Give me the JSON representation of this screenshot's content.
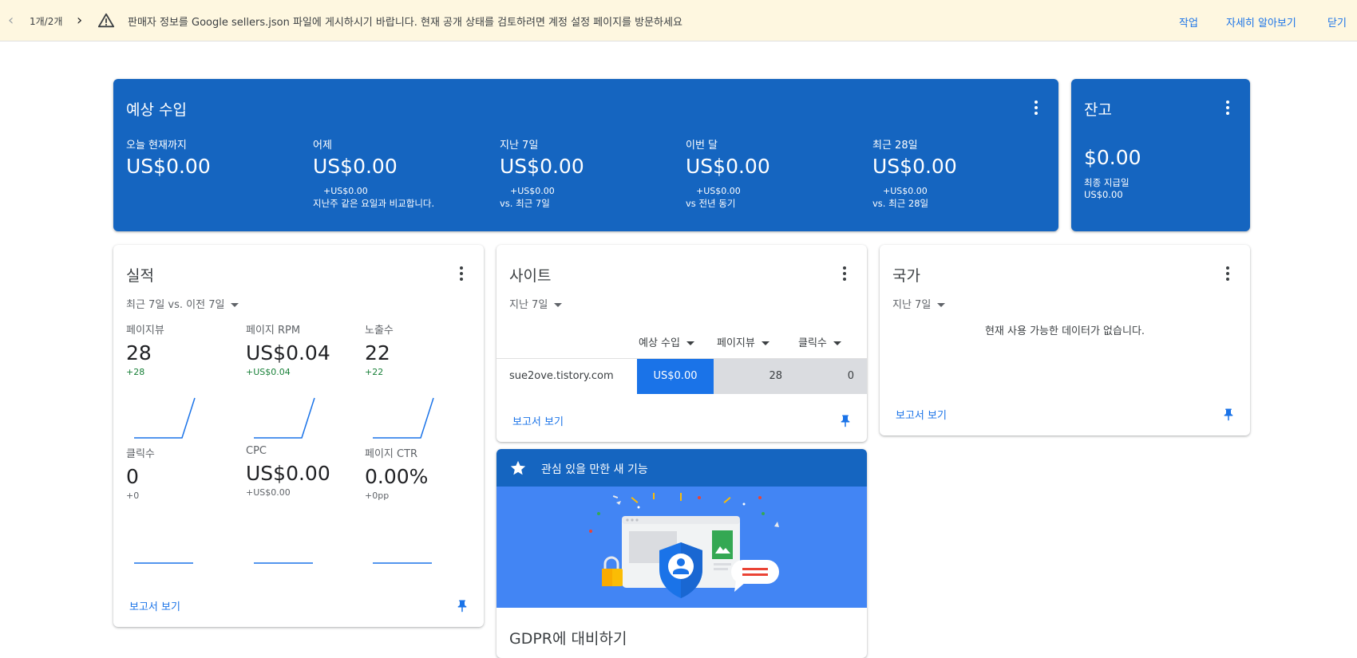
{
  "banner": {
    "counter": "1개/2개",
    "message": "판매자 정보를 Google sellers.json 파일에 게시하시기 바랍니다. 현재 공개 상태를 검토하려면 계정 설정 페이지를 방문하세요",
    "action": "작업",
    "learn_more": "자세히 알아보기",
    "close": "닫기"
  },
  "estimated": {
    "title": "예상 수입",
    "columns": [
      {
        "label": "오늘 현재까지",
        "value": "US$0.00",
        "delta": "",
        "compare": ""
      },
      {
        "label": "어제",
        "value": "US$0.00",
        "delta": "+US$0.00",
        "compare": "지난주 같은 요일과 비교합니다."
      },
      {
        "label": "지난 7일",
        "value": "US$0.00",
        "delta": "+US$0.00",
        "compare": "vs. 최근 7일"
      },
      {
        "label": "이번 달",
        "value": "US$0.00",
        "delta": "+US$0.00",
        "compare": "vs 전년 동기"
      },
      {
        "label": "최근 28일",
        "value": "US$0.00",
        "delta": "+US$0.00",
        "compare": "vs. 최근 28일"
      }
    ]
  },
  "balance": {
    "title": "잔고",
    "value": "$0.00",
    "label": "최종 지급일",
    "amount": "US$0.00"
  },
  "performance": {
    "title": "실적",
    "range": "최근 7일 vs. 이전 7일",
    "metrics": [
      {
        "label": "페이지뷰",
        "value": "28",
        "delta": "+28",
        "trend": "up"
      },
      {
        "label": "페이지 RPM",
        "value": "US$0.04",
        "delta": "+US$0.04",
        "trend": "up"
      },
      {
        "label": "노출수",
        "value": "22",
        "delta": "+22",
        "trend": "up"
      },
      {
        "label": "클릭수",
        "value": "0",
        "delta": "+0",
        "trend": "flat"
      },
      {
        "label": "CPC",
        "value": "US$0.00",
        "delta": "+US$0.00",
        "trend": "flat"
      },
      {
        "label": "페이지 CTR",
        "value": "0.00%",
        "delta": "+0pp",
        "trend": "flat"
      }
    ],
    "report_link": "보고서 보기"
  },
  "sites": {
    "title": "사이트",
    "range": "지난 7일",
    "headers": [
      "예상 수입",
      "페이지뷰",
      "클릭수"
    ],
    "rows": [
      {
        "site": "sue2ove.tistory.com",
        "earnings": "US$0.00",
        "pageviews": "28",
        "clicks": "0"
      }
    ],
    "report_link": "보고서 보기"
  },
  "countries": {
    "title": "국가",
    "range": "지난 7일",
    "empty": "현재 사용 가능한 데이터가 없습니다.",
    "report_link": "보고서 보기"
  },
  "feature": {
    "header": "관심 있을 만한 새 기능",
    "title": "GDPR에 대비하기"
  },
  "colors": {
    "card_blue": "#1565c0",
    "link_blue": "#1a73e8",
    "highlight_cell": "#1a73e8",
    "grey_cell": "#dadce0",
    "illustration_bg": "#4285f4"
  }
}
